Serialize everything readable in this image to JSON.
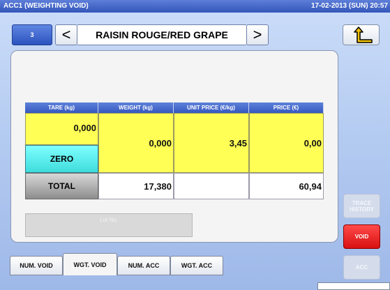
{
  "titlebar": {
    "title": "ACC1 (WEIGHTING VOID)",
    "datetime": "17-02-2013 (SUN) 20:57"
  },
  "product": {
    "plu": "3",
    "prev_label": "<",
    "name": "RAISIN ROUGE/RED GRAPE",
    "next_label": ">"
  },
  "back_icon": "return-arrow-icon",
  "table": {
    "headers": {
      "tare": "TARE (kg)",
      "weight": "WEIGHT (kg)",
      "unit_price": "UNIT PRICE (€/kg)",
      "price": "PRICE (€)"
    },
    "values": {
      "tare": "0,000",
      "weight": "0,000",
      "unit_price": "3,45",
      "price": "0,00"
    },
    "zero_label": "ZERO",
    "total": {
      "label": "TOTAL",
      "weight": "17,380",
      "unit_price": "",
      "price": "60,94"
    }
  },
  "lot": {
    "placeholder": "Lot No."
  },
  "tabs": [
    "NUM. VOID",
    "WGT. VOID",
    "NUM. ACC",
    "WGT. ACC"
  ],
  "side": {
    "trace": "TRACE HISTORY",
    "void": "VOID",
    "acc": "ACC"
  },
  "colors": {
    "yellow": "#ffff55",
    "cyan": "#5fefef",
    "void_red": "#e82020",
    "header_blue": "#3f63c8"
  }
}
